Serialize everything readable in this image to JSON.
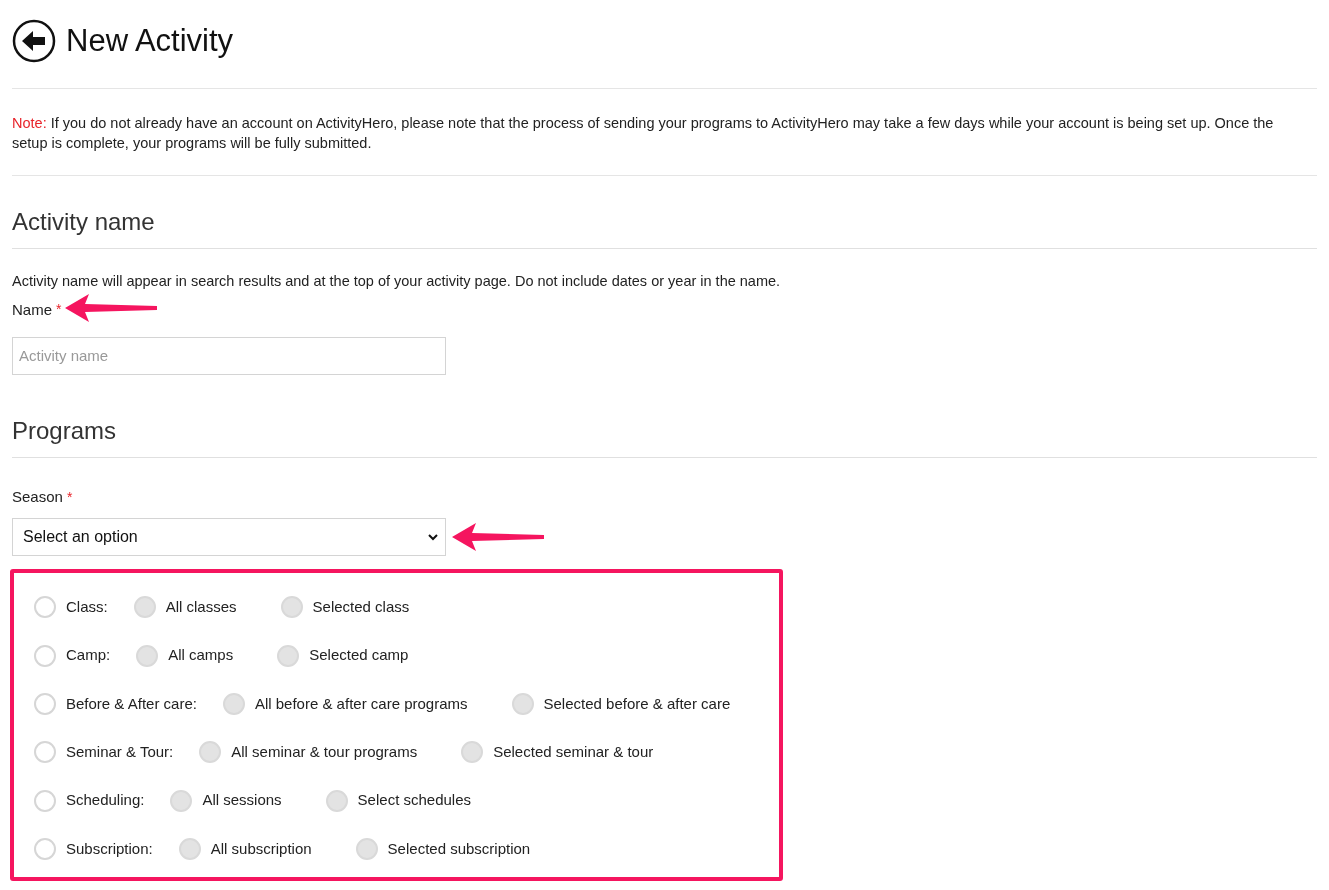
{
  "header": {
    "title": "New Activity"
  },
  "note": {
    "label": "Note:",
    "text": "If you do not already have an account on ActivityHero, please note that the process of sending your programs to ActivityHero may take a few days while your account is being set up. Once the setup is complete, your programs will be fully submitted."
  },
  "activity_name": {
    "heading": "Activity name",
    "description": "Activity name will appear in search results and at the top of your activity page. Do not include dates or year in the name.",
    "label": "Name",
    "required": "*",
    "placeholder": "Activity name"
  },
  "programs": {
    "heading": "Programs",
    "season_label": "Season",
    "required": "*",
    "season_value": "Select an option",
    "options": [
      {
        "label": "Class:",
        "checked": false,
        "choices": [
          {
            "label": "All classes",
            "disabled": true
          },
          {
            "label": "Selected class",
            "disabled": true
          }
        ]
      },
      {
        "label": "Camp:",
        "checked": false,
        "choices": [
          {
            "label": "All camps",
            "disabled": true
          },
          {
            "label": "Selected camp",
            "disabled": true
          }
        ]
      },
      {
        "label": "Before & After care:",
        "checked": false,
        "choices": [
          {
            "label": "All before & after care programs",
            "disabled": true
          },
          {
            "label": "Selected before & after care",
            "disabled": true
          }
        ]
      },
      {
        "label": "Seminar & Tour:",
        "checked": false,
        "choices": [
          {
            "label": "All seminar & tour programs",
            "disabled": true
          },
          {
            "label": "Selected seminar & tour",
            "disabled": true
          }
        ]
      },
      {
        "label": "Scheduling:",
        "checked": false,
        "choices": [
          {
            "label": "All sessions",
            "disabled": true
          },
          {
            "label": "Select schedules",
            "disabled": true
          }
        ]
      },
      {
        "label": "Subscription:",
        "checked": false,
        "choices": [
          {
            "label": "All subscription",
            "disabled": true
          },
          {
            "label": "Selected subscription",
            "disabled": true
          }
        ]
      }
    ]
  }
}
